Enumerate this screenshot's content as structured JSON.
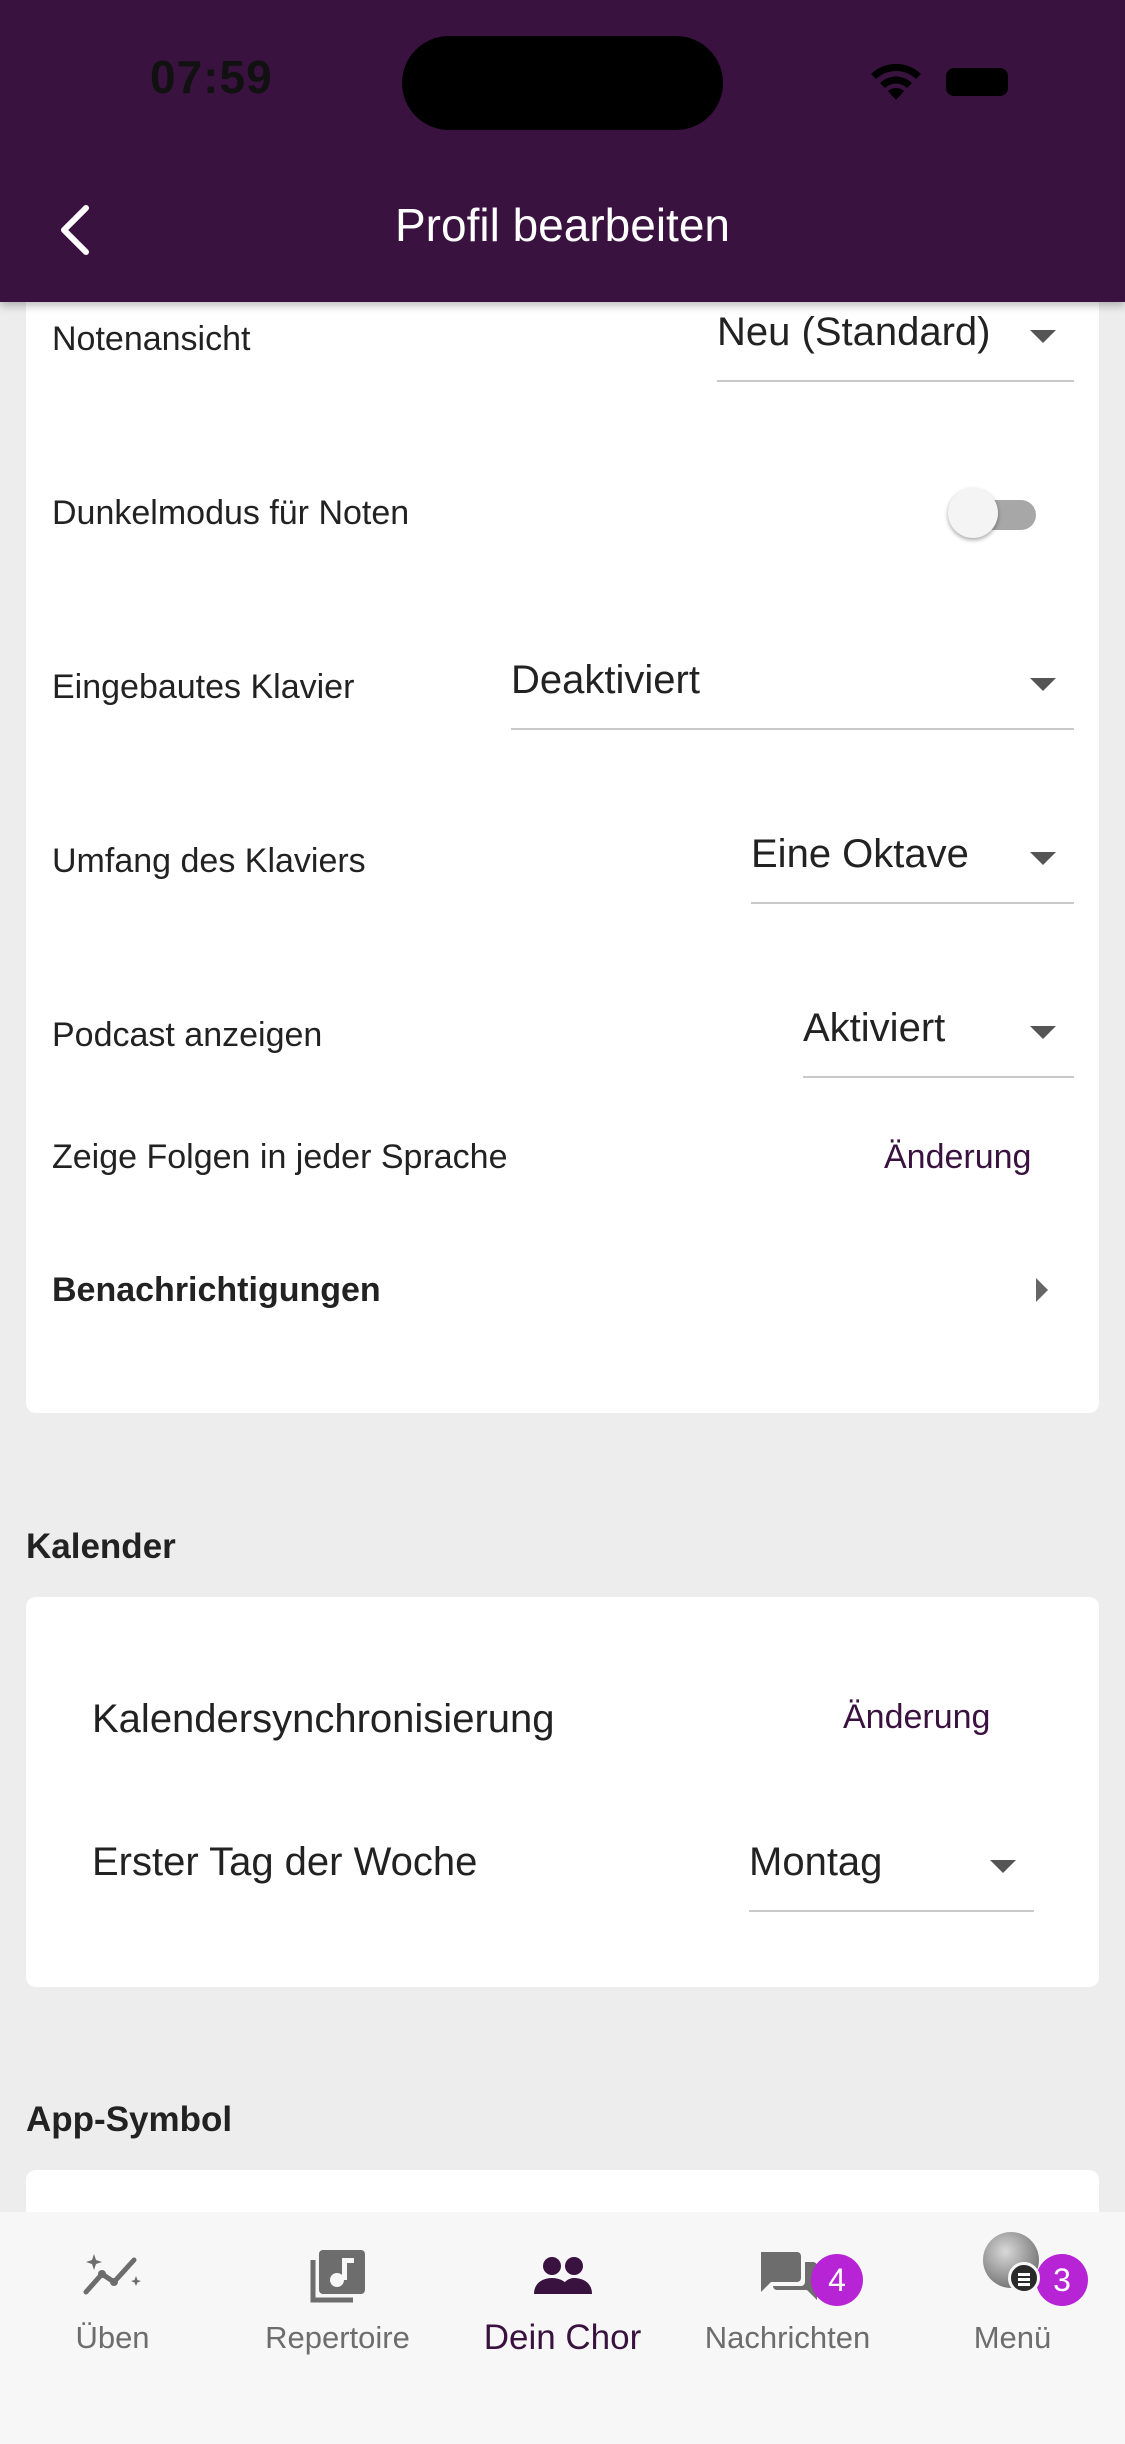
{
  "status_bar": {
    "time": "07:59"
  },
  "header": {
    "title": "Profil bearbeiten"
  },
  "settings": {
    "notenansicht": {
      "label": "Notenansicht",
      "value": "Neu (Standard)"
    },
    "dunkelmodus": {
      "label": "Dunkelmodus für Noten",
      "enabled": false
    },
    "klavier": {
      "label": "Eingebautes Klavier",
      "value": "Deaktiviert"
    },
    "umfang": {
      "label": "Umfang des Klaviers",
      "value": "Eine Oktave"
    },
    "podcast": {
      "label": "Podcast anzeigen",
      "value": "Aktiviert"
    },
    "folgen": {
      "label": "Zeige Folgen in jeder Sprache",
      "action": "Änderung"
    },
    "benachrichtigungen": {
      "label": "Benachrichtigungen"
    }
  },
  "calendar": {
    "section_title": "Kalender",
    "sync": {
      "label": "Kalendersynchronisierung",
      "action": "Änderung"
    },
    "first_day": {
      "label": "Erster Tag der Woche",
      "value": "Montag"
    }
  },
  "app_icon": {
    "section_title": "App-Symbol"
  },
  "bottom_nav": {
    "items": [
      {
        "label": "Üben",
        "icon": "practice-chart-icon"
      },
      {
        "label": "Repertoire",
        "icon": "music-note-library-icon"
      },
      {
        "label": "Dein Chor",
        "icon": "group-people-icon",
        "active": true
      },
      {
        "label": "Nachrichten",
        "icon": "chat-bubbles-icon",
        "badge": "4"
      },
      {
        "label": "Menü",
        "icon": "avatar",
        "badge": "3"
      }
    ]
  },
  "colors": {
    "primary": "#3a1240",
    "badge": "#b724d6",
    "background": "#ededed"
  }
}
